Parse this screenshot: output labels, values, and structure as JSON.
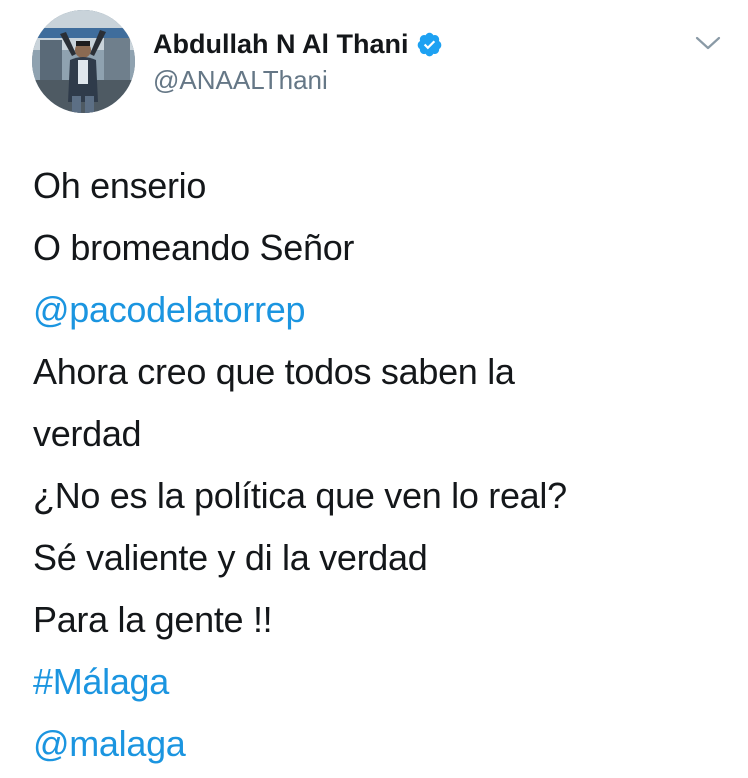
{
  "author": {
    "display_name": "Abdullah N Al Thani",
    "handle": "@ANAALThani",
    "verified": true,
    "avatar_icon": "profile-photo"
  },
  "menu": {
    "icon": "chevron-down-icon"
  },
  "tweet": {
    "lines": [
      {
        "text": "Oh enserio",
        "type": "text"
      },
      {
        "text": "O bromeando Señor",
        "type": "text"
      },
      {
        "text": "@pacodelatorrep",
        "type": "mention"
      },
      {
        "text": "Ahora creo que todos saben la",
        "type": "text"
      },
      {
        "text": "verdad",
        "type": "text"
      },
      {
        "text": "¿No es la política que ven lo real?",
        "type": "text"
      },
      {
        "text": "Sé valiente y di la verdad",
        "type": "text"
      },
      {
        "text": "Para la gente !!",
        "type": "text"
      },
      {
        "text": "#Málaga",
        "type": "hashtag"
      },
      {
        "text": "@malaga",
        "type": "mention"
      }
    ]
  },
  "colors": {
    "text": "#14171a",
    "secondary": "#657786",
    "link": "#1b95e0",
    "verified_badge": "#1da1f2"
  }
}
